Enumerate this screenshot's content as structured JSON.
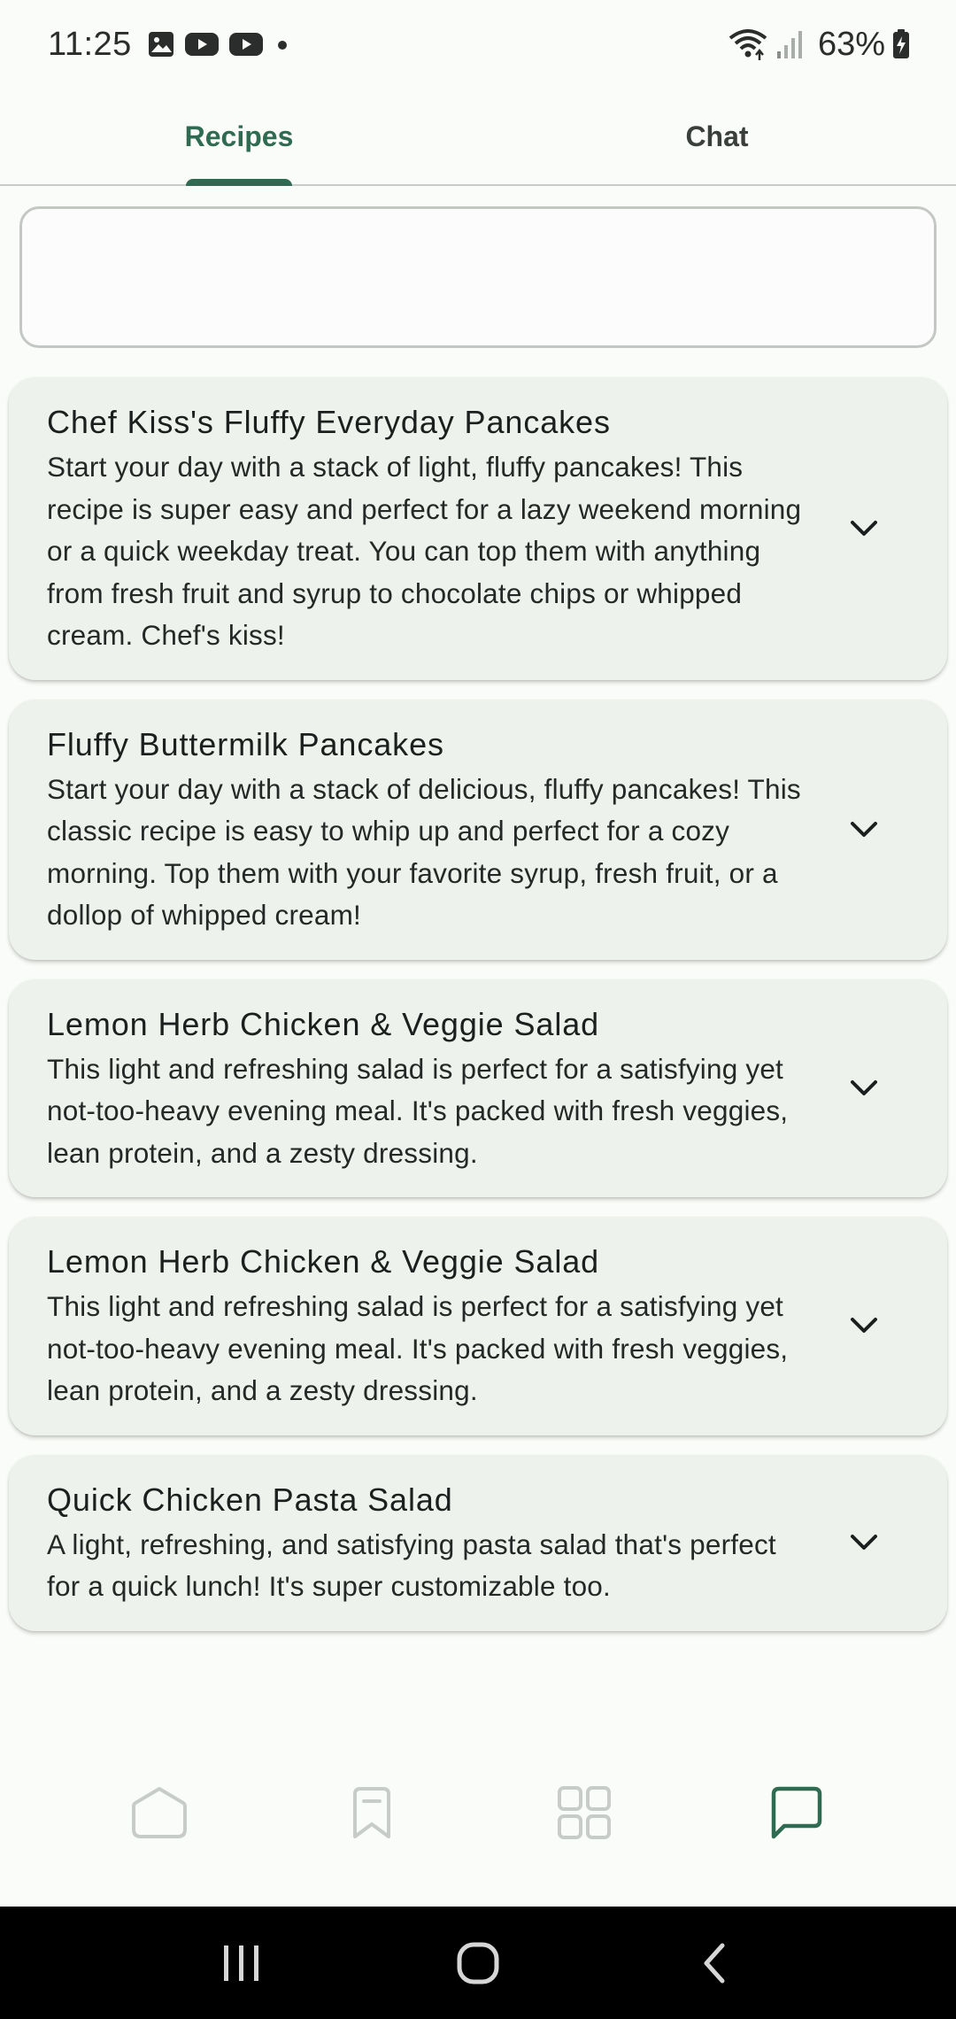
{
  "status_bar": {
    "time": "11:25",
    "battery": "63%",
    "icons": [
      "gallery-icon",
      "youtube-icon",
      "youtube-icon",
      "dot-icon",
      "wifi-icon",
      "signal-icon",
      "battery-charging-icon"
    ]
  },
  "tabs": [
    {
      "label": "Recipes",
      "active": true
    },
    {
      "label": "Chat",
      "active": false
    }
  ],
  "search": {
    "placeholder": "",
    "value": ""
  },
  "recipes": [
    {
      "title": "Chef Kiss's Fluffy Everyday Pancakes",
      "description": "Start your day with a stack of light, fluffy pancakes! This recipe is super easy and perfect for a lazy weekend morning or a quick weekday treat. You can top them with anything from fresh fruit and syrup to chocolate chips or whipped cream. Chef's kiss!"
    },
    {
      "title": "Fluffy Buttermilk Pancakes",
      "description": "Start your day with a stack of delicious, fluffy pancakes! This classic recipe is easy to whip up and perfect for a cozy morning. Top them with your favorite syrup, fresh fruit, or a dollop of whipped cream!"
    },
    {
      "title": "Lemon Herb Chicken & Veggie Salad",
      "description": "This light and refreshing salad is perfect for a satisfying yet not-too-heavy evening meal. It's packed with fresh veggies, lean protein, and a zesty dressing."
    },
    {
      "title": "Lemon Herb Chicken & Veggie Salad",
      "description": "This light and refreshing salad is perfect for a satisfying yet not-too-heavy evening meal. It's packed with fresh veggies, lean protein, and a zesty dressing."
    },
    {
      "title": "Quick Chicken Pasta Salad",
      "description": "A light, refreshing, and satisfying pasta salad that's perfect for a quick lunch! It's super customizable too."
    }
  ],
  "bottom_nav": [
    {
      "icon": "home-icon",
      "active": false
    },
    {
      "icon": "bookmark-icon",
      "active": false
    },
    {
      "icon": "grid-icon",
      "active": false
    },
    {
      "icon": "chat-bubble-icon",
      "active": true
    }
  ],
  "colors": {
    "accent": "#2f6b52",
    "card_background": "#edf2ec",
    "page_background": "#fafcf9",
    "inactive_icon": "#c8ccc9"
  }
}
